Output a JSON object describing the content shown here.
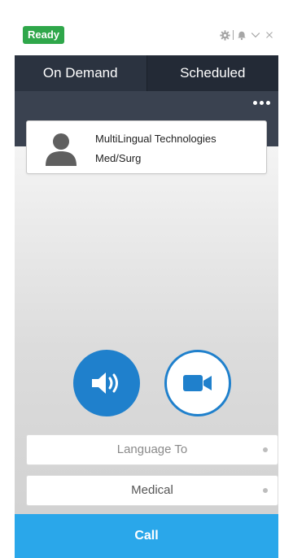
{
  "status": {
    "label": "Ready",
    "color": "#2fa74a"
  },
  "window_controls": {
    "icons": [
      "gear-icon",
      "bell-icon",
      "chevron-down-icon",
      "close-icon"
    ]
  },
  "tabs": [
    {
      "label": "On Demand",
      "active": true
    },
    {
      "label": "Scheduled",
      "active": false
    }
  ],
  "contact": {
    "name": "MultiLingual Technologies",
    "department": "Med/Surg",
    "icon": "person-icon"
  },
  "call_modes": {
    "audio_icon": "speaker-icon",
    "video_icon": "video-camera-icon",
    "accent": "#1f80cc"
  },
  "selects": {
    "language": {
      "value": "Language To"
    },
    "specialty": {
      "value": "Medical"
    }
  },
  "call_button": {
    "label": "Call",
    "color": "#2aa7ea"
  }
}
